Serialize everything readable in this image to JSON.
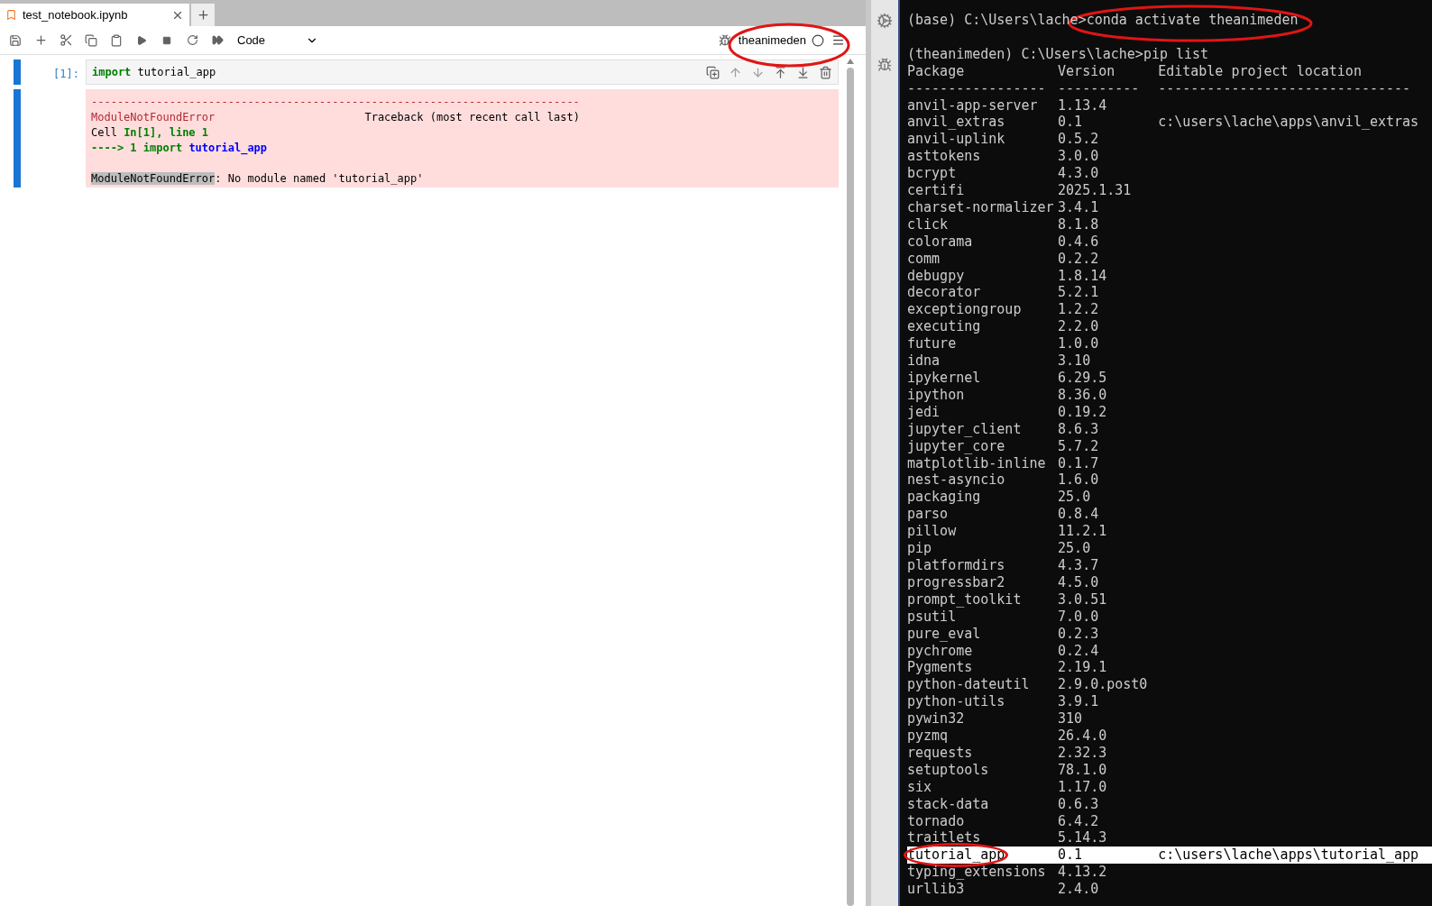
{
  "notebook": {
    "tab": {
      "title": "test_notebook.ipynb",
      "selected": true
    },
    "toolbar": {
      "cell_type": "Code",
      "kernel": "theanimeden",
      "kernel_busy": false
    },
    "cells": [
      {
        "prompt": "[1]:",
        "input": [
          {
            "kind": "keyword",
            "text": "import"
          },
          {
            "kind": "plain",
            "text": " tutorial_app"
          }
        ],
        "output": [
          {
            "kind": "text",
            "segments": [
              {
                "kind": "error",
                "text": "---------------------------------------------------------------------------"
              }
            ]
          },
          {
            "kind": "text",
            "segments": [
              {
                "kind": "error",
                "text": "ModuleNotFoundError"
              },
              {
                "kind": "plain",
                "text": "                       Traceback (most recent call last)"
              }
            ]
          },
          {
            "kind": "text",
            "segments": [
              {
                "kind": "plain",
                "text": "Cell "
              },
              {
                "kind": "green",
                "text": "In[1], line 1"
              }
            ]
          },
          {
            "kind": "text",
            "segments": [
              {
                "kind": "green",
                "text": "----> 1 import "
              },
              {
                "kind": "blue",
                "text": "tutorial_app"
              }
            ]
          },
          {
            "kind": "blank"
          },
          {
            "kind": "text",
            "segments": [
              {
                "kind": "highlight",
                "text": "ModuleNotFoundError"
              },
              {
                "kind": "plain",
                "text": ": No module named 'tutorial_app'"
              }
            ]
          }
        ]
      }
    ]
  },
  "terminal": {
    "lines": [
      {
        "kind": "text",
        "text": "(base) C:\\Users\\lache>conda activate theanimeden"
      },
      {
        "kind": "blank"
      },
      {
        "kind": "text",
        "text": "(theanimeden) C:\\Users\\lache>pip list"
      }
    ],
    "columns": [
      "Package",
      "Version",
      "Editable project location"
    ],
    "rules": [
      "-----------------",
      "----------",
      "-------------------------------"
    ],
    "packages": [
      {
        "name": "anvil-app-server",
        "version": "1.13.4",
        "selected": false,
        "circled": false
      },
      {
        "name": "anvil_extras",
        "version": "0.1",
        "location": "c:\\users\\lache\\apps\\anvil_extras",
        "selected": false,
        "circled": false
      },
      {
        "name": "anvil-uplink",
        "version": "0.5.2",
        "selected": false,
        "circled": false
      },
      {
        "name": "asttokens",
        "version": "3.0.0",
        "selected": false,
        "circled": false
      },
      {
        "name": "bcrypt",
        "version": "4.3.0",
        "selected": false,
        "circled": false
      },
      {
        "name": "certifi",
        "version": "2025.1.31",
        "selected": false,
        "circled": false
      },
      {
        "name": "charset-normalizer",
        "version": "3.4.1",
        "selected": false,
        "circled": false
      },
      {
        "name": "click",
        "version": "8.1.8",
        "selected": false,
        "circled": false
      },
      {
        "name": "colorama",
        "version": "0.4.6",
        "selected": false,
        "circled": false
      },
      {
        "name": "comm",
        "version": "0.2.2",
        "selected": false,
        "circled": false
      },
      {
        "name": "debugpy",
        "version": "1.8.14",
        "selected": false,
        "circled": false
      },
      {
        "name": "decorator",
        "version": "5.2.1",
        "selected": false,
        "circled": false
      },
      {
        "name": "exceptiongroup",
        "version": "1.2.2",
        "selected": false,
        "circled": false
      },
      {
        "name": "executing",
        "version": "2.2.0",
        "selected": false,
        "circled": false
      },
      {
        "name": "future",
        "version": "1.0.0",
        "selected": false,
        "circled": false
      },
      {
        "name": "idna",
        "version": "3.10",
        "selected": false,
        "circled": false
      },
      {
        "name": "ipykernel",
        "version": "6.29.5",
        "selected": false,
        "circled": false
      },
      {
        "name": "ipython",
        "version": "8.36.0",
        "selected": false,
        "circled": false
      },
      {
        "name": "jedi",
        "version": "0.19.2",
        "selected": false,
        "circled": false
      },
      {
        "name": "jupyter_client",
        "version": "8.6.3",
        "selected": false,
        "circled": false
      },
      {
        "name": "jupyter_core",
        "version": "5.7.2",
        "selected": false,
        "circled": false
      },
      {
        "name": "matplotlib-inline",
        "version": "0.1.7",
        "selected": false,
        "circled": false
      },
      {
        "name": "nest-asyncio",
        "version": "1.6.0",
        "selected": false,
        "circled": false
      },
      {
        "name": "packaging",
        "version": "25.0",
        "selected": false,
        "circled": false
      },
      {
        "name": "parso",
        "version": "0.8.4",
        "selected": false,
        "circled": false
      },
      {
        "name": "pillow",
        "version": "11.2.1",
        "selected": false,
        "circled": false
      },
      {
        "name": "pip",
        "version": "25.0",
        "selected": false,
        "circled": false
      },
      {
        "name": "platformdirs",
        "version": "4.3.7",
        "selected": false,
        "circled": false
      },
      {
        "name": "progressbar2",
        "version": "4.5.0",
        "selected": false,
        "circled": false
      },
      {
        "name": "prompt_toolkit",
        "version": "3.0.51",
        "selected": false,
        "circled": false
      },
      {
        "name": "psutil",
        "version": "7.0.0",
        "selected": false,
        "circled": false
      },
      {
        "name": "pure_eval",
        "version": "0.2.3",
        "selected": false,
        "circled": false
      },
      {
        "name": "pychrome",
        "version": "0.2.4",
        "selected": false,
        "circled": false
      },
      {
        "name": "Pygments",
        "version": "2.19.1",
        "selected": false,
        "circled": false
      },
      {
        "name": "python-dateutil",
        "version": "2.9.0.post0",
        "selected": false,
        "circled": false
      },
      {
        "name": "python-utils",
        "version": "3.9.1",
        "selected": false,
        "circled": false
      },
      {
        "name": "pywin32",
        "version": "310",
        "selected": false,
        "circled": false
      },
      {
        "name": "pyzmq",
        "version": "26.4.0",
        "selected": false,
        "circled": false
      },
      {
        "name": "requests",
        "version": "2.32.3",
        "selected": false,
        "circled": false
      },
      {
        "name": "setuptools",
        "version": "78.1.0",
        "selected": false,
        "circled": false
      },
      {
        "name": "six",
        "version": "1.17.0",
        "selected": false,
        "circled": false
      },
      {
        "name": "stack-data",
        "version": "0.6.3",
        "selected": false,
        "circled": false
      },
      {
        "name": "tornado",
        "version": "6.4.2",
        "selected": false,
        "circled": false
      },
      {
        "name": "traitlets",
        "version": "5.14.3",
        "selected": false,
        "circled": false
      },
      {
        "name": "tutorial_app",
        "version": "0.1",
        "location": "c:\\users\\lache\\apps\\tutorial_app",
        "selected": true,
        "circled": true
      },
      {
        "name": "typing_extensions",
        "version": "4.13.2",
        "selected": false,
        "circled": false
      },
      {
        "name": "urllib3",
        "version": "2.4.0",
        "selected": false,
        "circled": false
      }
    ]
  }
}
